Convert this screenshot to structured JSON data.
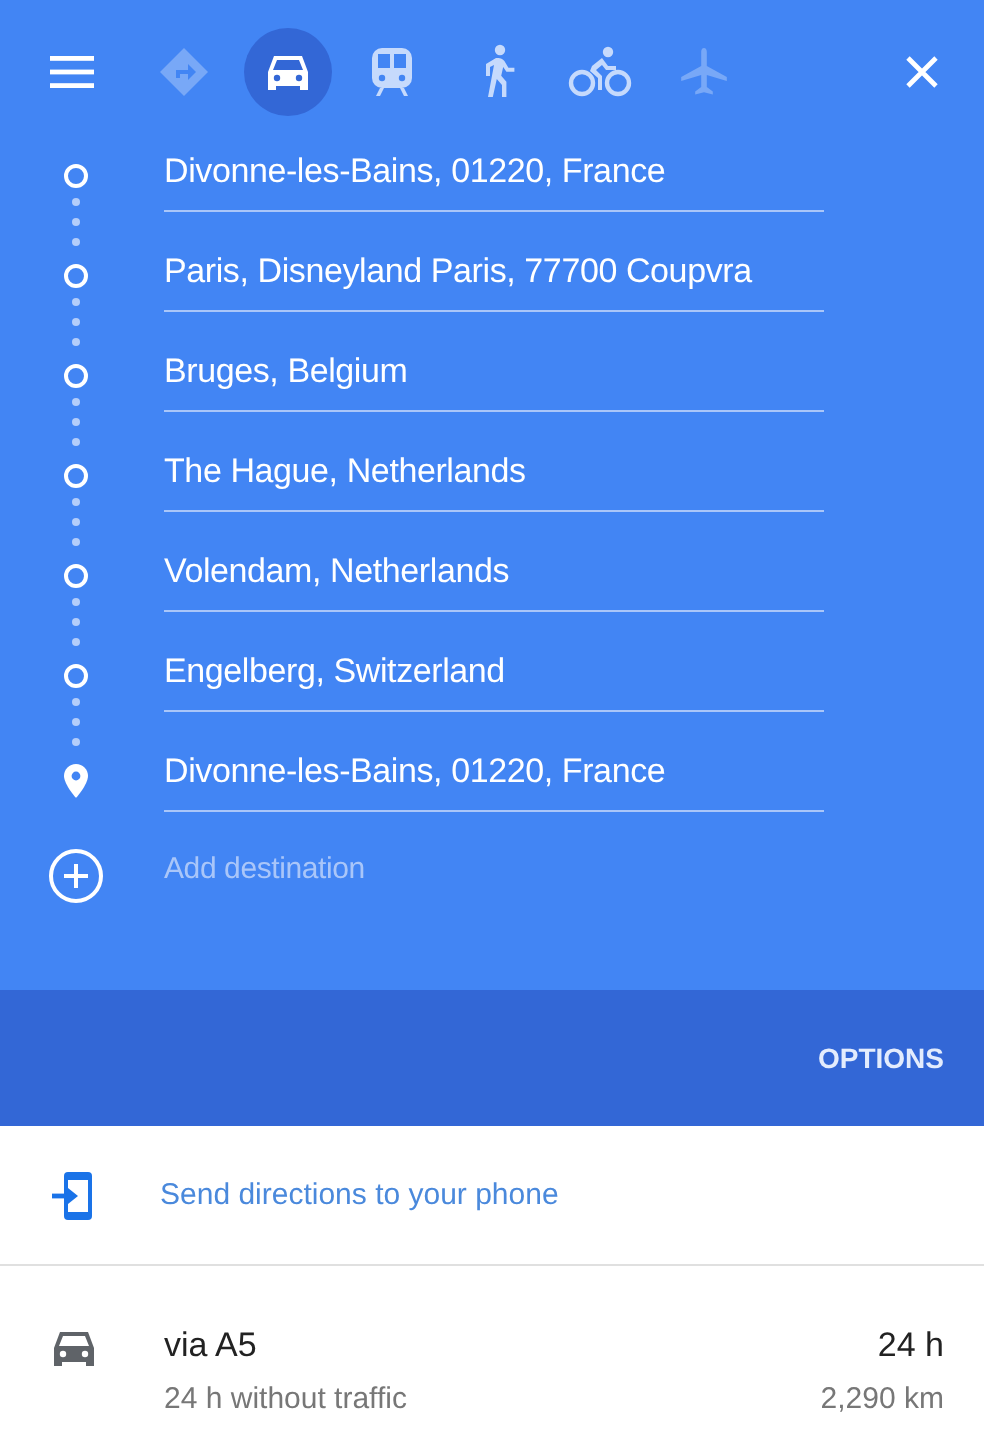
{
  "modes": [
    {
      "kind": "best",
      "selected": false,
      "disabled": true
    },
    {
      "kind": "car",
      "selected": true,
      "disabled": false
    },
    {
      "kind": "train",
      "selected": false,
      "disabled": false
    },
    {
      "kind": "walk",
      "selected": false,
      "disabled": false
    },
    {
      "kind": "bike",
      "selected": false,
      "disabled": false
    },
    {
      "kind": "flight",
      "selected": false,
      "disabled": true
    }
  ],
  "stops": [
    {
      "kind": "stop",
      "value": "Divonne-les-Bains, 01220, France"
    },
    {
      "kind": "stop",
      "value": "Paris, Disneyland Paris, 77700 Coupvra"
    },
    {
      "kind": "stop",
      "value": "Bruges, Belgium"
    },
    {
      "kind": "stop",
      "value": "The Hague, Netherlands"
    },
    {
      "kind": "stop",
      "value": "Volendam, Netherlands"
    },
    {
      "kind": "stop",
      "value": "Engelberg, Switzerland"
    },
    {
      "kind": "destination",
      "value": "Divonne-les-Bains, 01220, France"
    }
  ],
  "add_destination": {
    "placeholder": "Add destination"
  },
  "options_button": "OPTIONS",
  "send_link": "Send directions to your phone",
  "route": {
    "name": "via A5",
    "duration": "24 h",
    "note": "24 h without traffic",
    "distance": "2,290 km"
  }
}
